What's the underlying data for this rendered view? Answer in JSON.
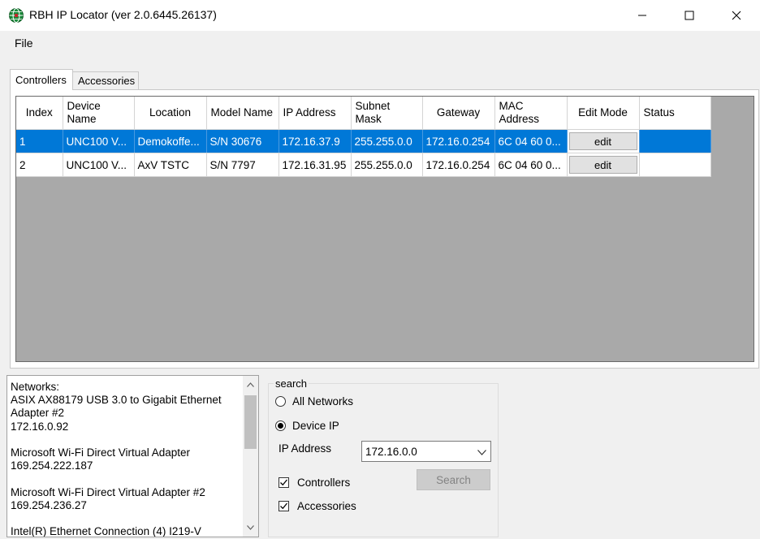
{
  "window": {
    "title": "RBH IP Locator (ver 2.0.6445.26137)"
  },
  "menu": {
    "file": "File"
  },
  "tabs": [
    {
      "label": "Controllers",
      "active": true
    },
    {
      "label": "Accessories",
      "active": false
    }
  ],
  "grid": {
    "headers": {
      "index": "Index",
      "device_name": "Device Name",
      "location": "Location",
      "model_name": "Model Name",
      "ip_address": "IP Address",
      "subnet_mask": "Subnet Mask",
      "gateway": "Gateway",
      "mac_address": "MAC Address",
      "edit_mode": "Edit Mode",
      "status": "Status"
    },
    "rows": [
      {
        "index": "1",
        "device_name": "UNC100 V...",
        "location": "Demokoffe...",
        "model_name": "S/N 30676",
        "ip_address": "172.16.37.9",
        "subnet_mask": "255.255.0.0",
        "gateway": "172.16.0.254",
        "mac_address": "6C 04 60 0...",
        "edit_label": "edit",
        "status": "",
        "selected": true
      },
      {
        "index": "2",
        "device_name": "UNC100 V...",
        "location": "AxV TSTC",
        "model_name": "S/N 7797",
        "ip_address": "172.16.31.95",
        "subnet_mask": "255.255.0.0",
        "gateway": "172.16.0.254",
        "mac_address": "6C 04 60 0...",
        "edit_label": "edit",
        "status": "",
        "selected": false
      }
    ]
  },
  "networks": {
    "text": "Networks:\nASIX AX88179 USB 3.0 to Gigabit Ethernet Adapter #2\n172.16.0.92\n\nMicrosoft Wi-Fi Direct Virtual Adapter\n169.254.222.187\n\nMicrosoft Wi-Fi Direct Virtual Adapter #2\n169.254.236.27\n\nIntel(R) Ethernet Connection (4) I219-V"
  },
  "search": {
    "legend": "search",
    "radio_all_networks": "All Networks",
    "radio_device_ip": "Device IP",
    "selected_radio": "device_ip",
    "ip_label": "IP Address",
    "ip_value": "172.16.0.0",
    "search_button": "Search",
    "check_controllers": "Controllers",
    "check_accessories": "Accessories",
    "controllers_checked": true,
    "accessories_checked": true
  },
  "colors": {
    "selection": "#0078d7",
    "grid_background": "#a9a9a9",
    "window_background": "#f0f0f0"
  }
}
